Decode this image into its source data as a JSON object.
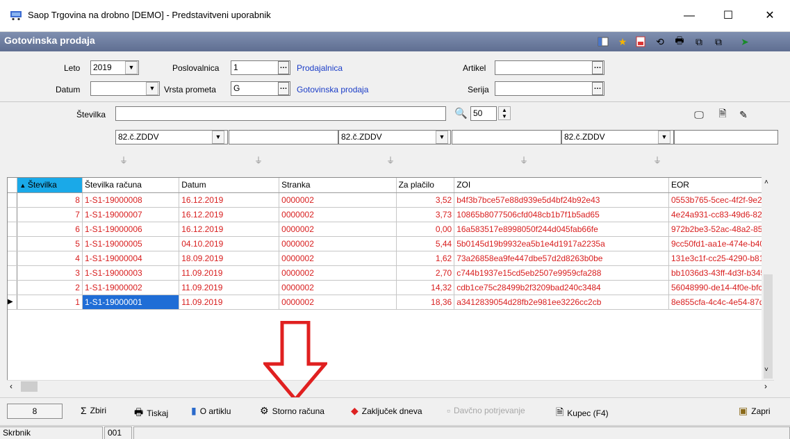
{
  "window": {
    "title": "Saop Trgovina na drobno [DEMO] - Predstavitveni uporabnik",
    "minimize_glyph": "—",
    "maximize_glyph": "☐",
    "close_glyph": "✕"
  },
  "module_title": "Gotovinska prodaja",
  "filters": {
    "leto_label": "Leto",
    "leto_value": "2019",
    "datum_label": "Datum",
    "datum_value": "",
    "poslovalnica_label": "Poslovalnica",
    "poslovalnica_value": "1",
    "poslovalnica_link": "Prodajalnica",
    "vrsta_label": "Vrsta prometa",
    "vrsta_value": "G",
    "vrsta_link": "Gotovinska prodaja",
    "artikel_label": "Artikel",
    "artikel_value": "",
    "serija_label": "Serija",
    "serija_value": "",
    "stevilka_label": "Številka",
    "stevilka_value": "",
    "page_size": "50",
    "col_filter_1": "82.č.ZDDV",
    "col_filter_2": "82.č.ZDDV",
    "col_filter_3": "82.č.ZDDV"
  },
  "grid": {
    "columns": [
      "Številka",
      "Številka računa",
      "Datum",
      "Stranka",
      "Za plačilo",
      "ZOI",
      "EOR"
    ],
    "rows": [
      [
        "8",
        "1-S1-19000008",
        "16.12.2019",
        "0000002",
        "3,52",
        "b4f3b7bce57e88d939e5d4bf24b92e43",
        "0553b765-5cec-4f2f-9e2a"
      ],
      [
        "7",
        "1-S1-19000007",
        "16.12.2019",
        "0000002",
        "3,73",
        "10865b8077506cfd048cb1b7f1b5ad65",
        "4e24a931-cc83-49d6-827"
      ],
      [
        "6",
        "1-S1-19000006",
        "16.12.2019",
        "0000002",
        "0,00",
        "16a583517e8998050f244d045fab66fe",
        "972b2be3-52ac-48a2-852"
      ],
      [
        "5",
        "1-S1-19000005",
        "04.10.2019",
        "0000002",
        "5,44",
        "5b0145d19b9932ea5b1e4d1917a2235a",
        "9cc50fd1-aa1e-474e-b40"
      ],
      [
        "4",
        "1-S1-19000004",
        "18.09.2019",
        "0000002",
        "1,62",
        "73a26858ea9fe447dbe57d2d8263b0be",
        "131e3c1f-cc25-4290-b81e"
      ],
      [
        "3",
        "1-S1-19000003",
        "11.09.2019",
        "0000002",
        "2,70",
        "c744b1937e15cd5eb2507e9959cfa288",
        "bb1036d3-43ff-4d3f-b345"
      ],
      [
        "2",
        "1-S1-19000002",
        "11.09.2019",
        "0000002",
        "14,32",
        "cdb1ce75c28499b2f3209bad240c3484",
        "56048990-de14-4f0e-bfca"
      ],
      [
        "1",
        "1-S1-19000001",
        "11.09.2019",
        "0000002",
        "18,36",
        "a3412839054d28fb2e981ee3226cc2cb",
        "8e855cfa-4c4c-4e54-87dc"
      ]
    ],
    "selected_row_index": 7
  },
  "bottom": {
    "count": "8",
    "zbiri": "Zbiri",
    "tiskaj": "Tiskaj",
    "o_artiklu": "O artiklu",
    "storno": "Storno računa",
    "zakljucek": "Zaključek dneva",
    "davcno": "Davčno potrjevanje",
    "kupec": "Kupec (F4)",
    "zapri": "Zapri"
  },
  "status": {
    "user_label": "Skrbnik",
    "code": "001"
  },
  "colors": {
    "band": "#6f7fa3",
    "row_text": "#d81e1e",
    "sort_header": "#1aa9e8",
    "selection": "#1f6dd6",
    "arrow": "#e02020",
    "link": "#1a3cc7"
  }
}
